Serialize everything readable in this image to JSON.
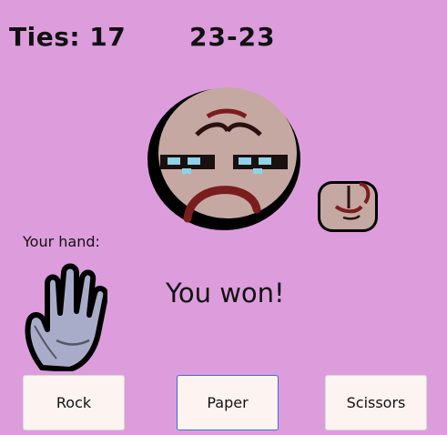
{
  "scoreboard": {
    "ties": "Ties: 17",
    "score": "23-23"
  },
  "player": {
    "hand_label": "Your hand:",
    "current_hand": "paper"
  },
  "opponent": {
    "expression": "sad-crying",
    "current_hand": "rock"
  },
  "result": {
    "text": "You won!"
  },
  "choices": {
    "rock": "Rock",
    "paper": "Paper",
    "scissors": "Scissors"
  },
  "colors": {
    "background": "#dd9ddd",
    "button_bg": "#fdf3f0",
    "focused_border": "#3c6fd6",
    "face_skin": "#c6a8a3",
    "glove": "#a9acc9"
  }
}
